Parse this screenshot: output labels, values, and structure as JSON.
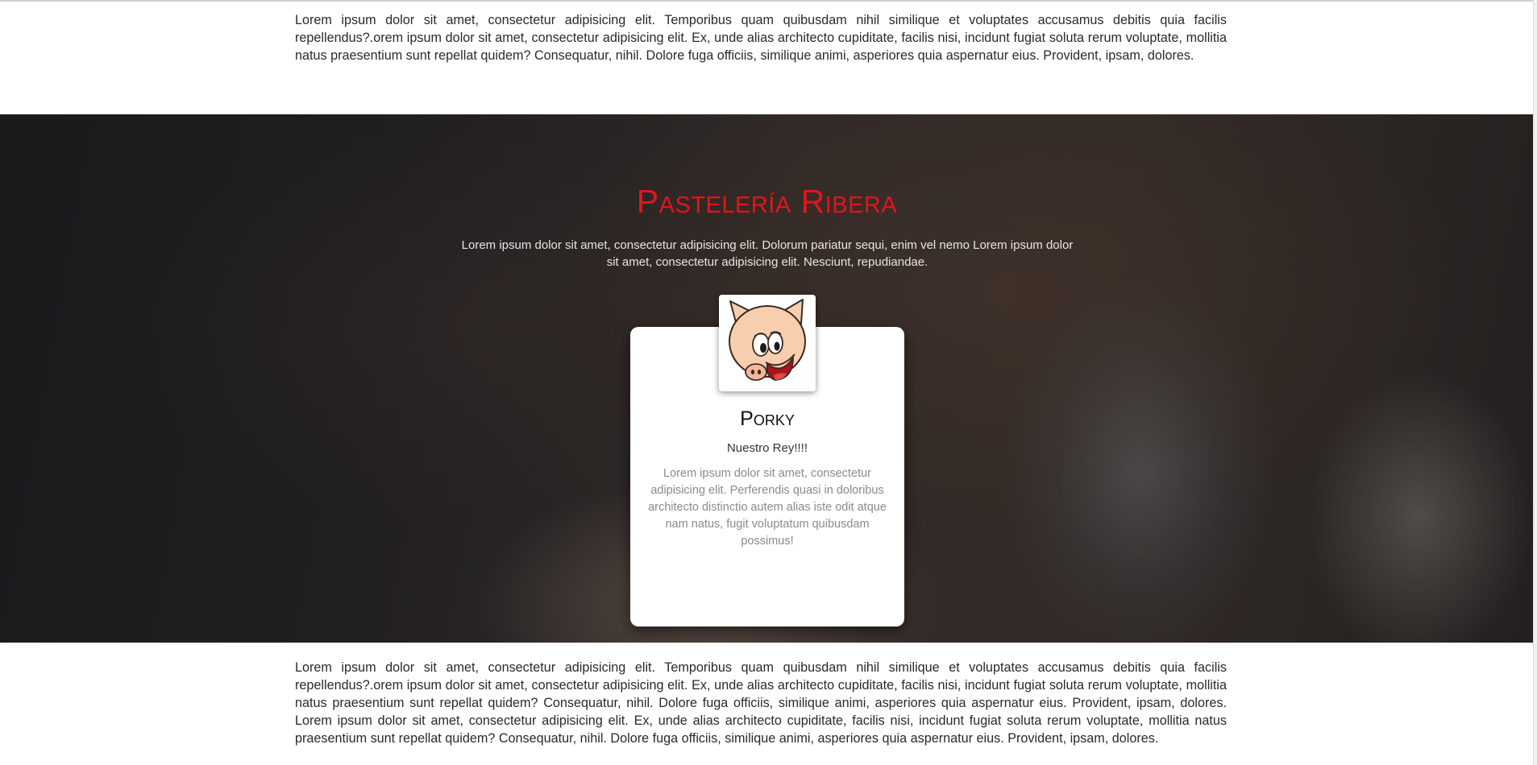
{
  "intro": {
    "text": "Lorem ipsum dolor sit amet, consectetur adipisicing elit. Temporibus quam quibusdam nihil similique et voluptates accusamus debitis quia facilis repellendus?.orem ipsum dolor sit amet, consectetur adipisicing elit. Ex, unde alias architecto cupiditate, facilis nisi, incidunt fugiat soluta rerum voluptate, mollitia natus praesentium sunt repellat quidem? Consequatur, nihil. Dolore fuga officiis, similique animi, asperiores quia aspernatur eius. Provident, ipsam, dolores."
  },
  "hero": {
    "title": "Pastelería Ribera",
    "subtitle": "Lorem ipsum dolor sit amet, consectetur adipisicing elit. Dolorum pariatur sequi, enim vel nemo Lorem ipsum dolor sit amet, consectetur adipisicing elit. Nesciunt, repudiandae.",
    "title_color": "#e2151b"
  },
  "card": {
    "avatar_icon": "porky-pig-avatar-icon",
    "name": "Porky",
    "role": "Nuestro Rey!!!!",
    "description": "Lorem ipsum dolor sit amet, consectetur adipisicing elit. Perferendis quasi in doloribus architecto distinctio autem alias iste odit atque nam natus, fugit voluptatum quibusdam possimus!"
  },
  "outro": {
    "text": "Lorem ipsum dolor sit amet, consectetur adipisicing elit. Temporibus quam quibusdam nihil similique et voluptates accusamus debitis quia facilis repellendus?.orem ipsum dolor sit amet, consectetur adipisicing elit. Ex, unde alias architecto cupiditate, facilis nisi, incidunt fugiat soluta rerum voluptate, mollitia natus praesentium sunt repellat quidem? Consequatur, nihil. Dolore fuga officiis, similique animi, asperiores quia aspernatur eius. Provident, ipsam, dolores. Lorem ipsum dolor sit amet, consectetur adipisicing elit. Ex, unde alias architecto cupiditate, facilis nisi, incidunt fugiat soluta rerum voluptate, mollitia natus praesentium sunt repellat quidem? Consequatur, nihil. Dolore fuga officiis, similique animi, asperiores quia aspernatur eius. Provident, ipsam, dolores."
  }
}
